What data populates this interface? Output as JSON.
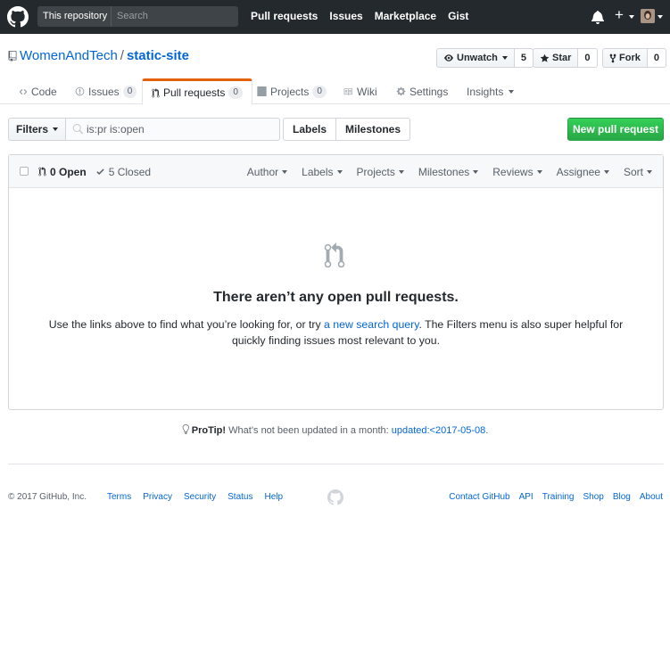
{
  "header": {
    "scope_label": "This repository",
    "search_placeholder": "Search",
    "nav": [
      "Pull requests",
      "Issues",
      "Marketplace",
      "Gist"
    ]
  },
  "repo": {
    "owner": "WomenAndTech",
    "separator": "/",
    "name": "static-site",
    "watch": {
      "label": "Unwatch",
      "count": "5"
    },
    "star": {
      "label": "Star",
      "count": "0"
    },
    "fork": {
      "label": "Fork",
      "count": "0"
    }
  },
  "tabs": {
    "code": "Code",
    "issues": {
      "label": "Issues",
      "count": "0"
    },
    "pulls": {
      "label": "Pull requests",
      "count": "0"
    },
    "projects": {
      "label": "Projects",
      "count": "0"
    },
    "wiki": "Wiki",
    "settings": "Settings",
    "insights": "Insights"
  },
  "filters": {
    "button": "Filters",
    "query": "is:pr is:open",
    "labels": "Labels",
    "milestones": "Milestones",
    "new_pr": "New pull request"
  },
  "list": {
    "open": "0 Open",
    "closed": "5 Closed",
    "menus": [
      "Author",
      "Labels",
      "Projects",
      "Milestones",
      "Reviews",
      "Assignee",
      "Sort"
    ]
  },
  "blankslate": {
    "title": "There aren’t any open pull requests.",
    "text_before": "Use the links above to find what you’re looking for, or try ",
    "link": "a new search query",
    "text_after": ". The Filters menu is also super helpful for quickly finding issues most relevant to you."
  },
  "protip": {
    "label": "ProTip!",
    "text": " What’s not been updated in a month: ",
    "link": "updated:<2017-05-08",
    "end": "."
  },
  "footer": {
    "copyright": "© 2017 GitHub, Inc.",
    "left_links": [
      "Terms",
      "Privacy",
      "Security",
      "Status",
      "Help"
    ],
    "right_links": [
      "Contact GitHub",
      "API",
      "Training",
      "Shop",
      "Blog",
      "About"
    ]
  },
  "colors": {
    "header_bg": "#24292e",
    "link": "#0366d6",
    "selected_tab_accent": "#e36209",
    "new_pr_green": "#28a745"
  }
}
